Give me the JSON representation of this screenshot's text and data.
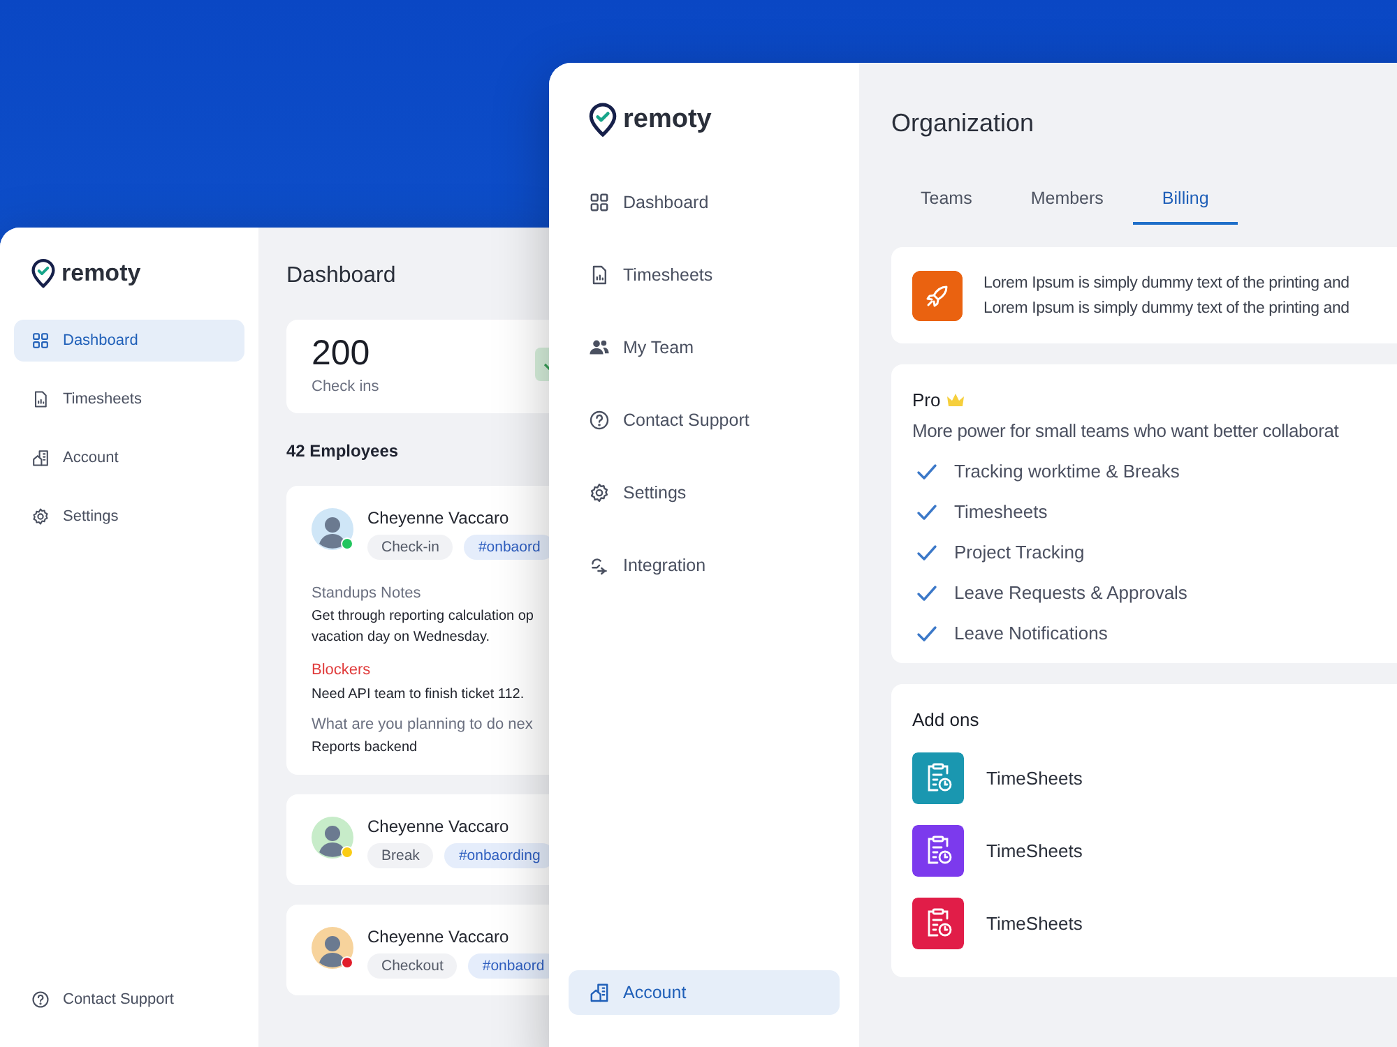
{
  "back_window": {
    "logo": "remoty",
    "sidebar": {
      "items": [
        {
          "label": "Dashboard",
          "selected": true
        },
        {
          "label": "Timesheets",
          "selected": false
        },
        {
          "label": "Account",
          "selected": false
        },
        {
          "label": "Settings",
          "selected": false
        }
      ],
      "footer_item": {
        "label": "Contact Support",
        "selected": false
      }
    },
    "title": "Dashboard",
    "stat": {
      "value": "200",
      "label": "Check ins"
    },
    "employees_heading": "42 Employees",
    "employees": [
      {
        "name": "Cheyenne Vaccaro",
        "color": "#22c55e",
        "status": "Check-in",
        "channel": "#onbaord",
        "notes": [
          {
            "kind": "heading",
            "text": "Standups Notes"
          },
          {
            "kind": "body",
            "text": "Get through reporting calculation op"
          },
          {
            "kind": "body",
            "text": "vacation day on Wednesday."
          },
          {
            "kind": "alert",
            "text": "Blockers"
          },
          {
            "kind": "body",
            "text": "Need API team to finish ticket 112."
          },
          {
            "kind": "heading",
            "text": "What are you planning to do nex"
          },
          {
            "kind": "body",
            "text": "Reports backend"
          }
        ]
      },
      {
        "name": "Cheyenne Vaccaro",
        "color": "#facc15",
        "status": "Break",
        "channel": "#onbaording"
      },
      {
        "name": "Cheyenne Vaccaro",
        "color": "#e11d2a",
        "status": "Checkout",
        "channel": "#onbaord"
      }
    ]
  },
  "front_window": {
    "logo": "remoty",
    "sidebar": {
      "items": [
        {
          "label": "Dashboard",
          "selected": false
        },
        {
          "label": "Timesheets",
          "selected": false
        },
        {
          "label": "My Team",
          "selected": false
        },
        {
          "label": "Contact Support",
          "selected": false
        },
        {
          "label": "Settings",
          "selected": false
        },
        {
          "label": "Integration",
          "selected": false
        }
      ],
      "footer_item": {
        "label": "Account",
        "selected": true
      }
    },
    "title": "Organization",
    "tabs": [
      {
        "label": "Teams",
        "selected": false
      },
      {
        "label": "Members",
        "selected": false
      },
      {
        "label": "Billing",
        "selected": true
      }
    ],
    "notice": {
      "lines": [
        "Lorem Ipsum is simply dummy text of the printing and",
        "Lorem Ipsum is simply dummy text of the printing and"
      ]
    },
    "plan": {
      "name": "Pro",
      "description": "More power for small teams who want better collaborat",
      "features": [
        "Tracking worktime & Breaks",
        "Timesheets",
        "Project Tracking",
        "Leave Requests & Approvals",
        "Leave Notifications"
      ]
    },
    "addons": {
      "heading": "Add ons",
      "items": [
        {
          "label": "TimeSheets",
          "color": "#1a97b0"
        },
        {
          "label": "TimeSheets",
          "color": "#7c3aed"
        },
        {
          "label": "TimeSheets",
          "color": "#e11d48"
        }
      ]
    }
  }
}
